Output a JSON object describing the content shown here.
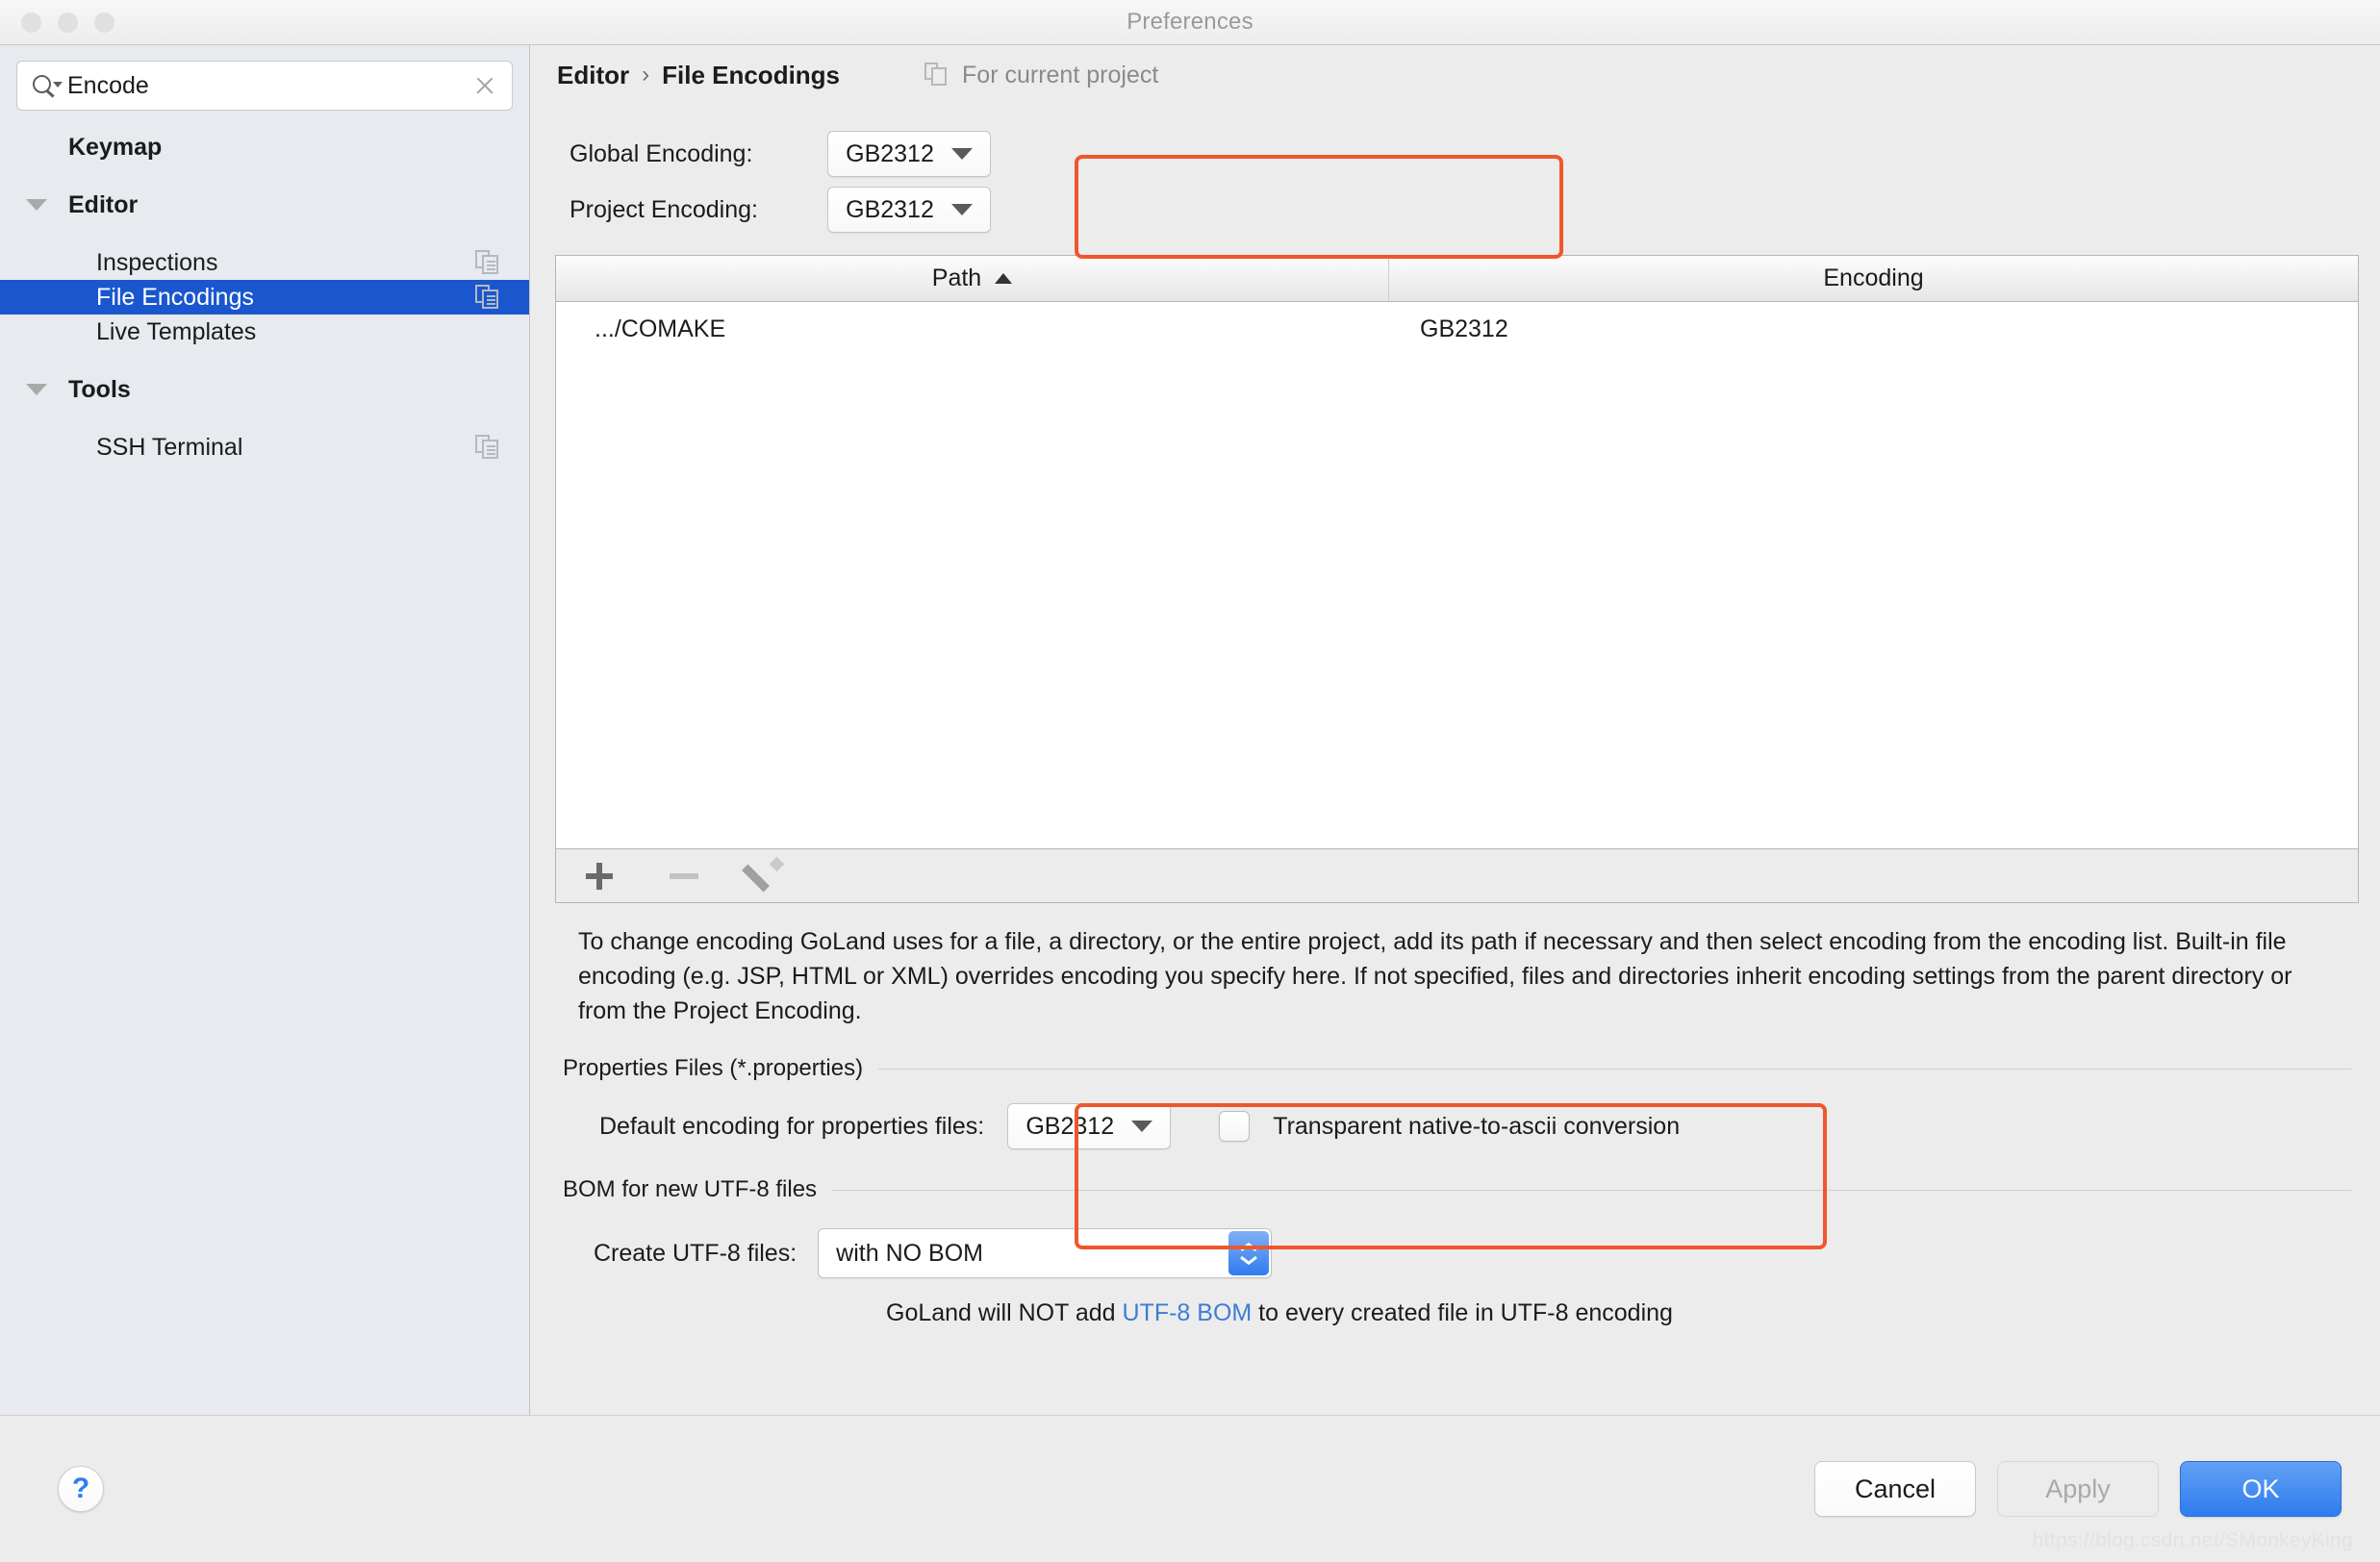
{
  "window": {
    "title": "Preferences"
  },
  "search": {
    "value": "Encode",
    "placeholder": "Search"
  },
  "sidebar": {
    "items": [
      {
        "label": "Keymap",
        "level": "top",
        "twisty": false,
        "copy": false,
        "selected": false
      },
      {
        "label": "Editor",
        "level": "top",
        "twisty": true,
        "copy": false,
        "selected": false
      },
      {
        "label": "Inspections",
        "level": "child",
        "twisty": false,
        "copy": true,
        "selected": false
      },
      {
        "label": "File Encodings",
        "level": "child",
        "twisty": false,
        "copy": true,
        "selected": true
      },
      {
        "label": "Live Templates",
        "level": "child",
        "twisty": false,
        "copy": false,
        "selected": false
      },
      {
        "label": "Tools",
        "level": "top",
        "twisty": true,
        "copy": false,
        "selected": false
      },
      {
        "label": "SSH Terminal",
        "level": "child",
        "twisty": false,
        "copy": true,
        "selected": false
      }
    ]
  },
  "header": {
    "breadcrumb_parent": "Editor",
    "breadcrumb_sep": "›",
    "breadcrumb_current": "File Encodings",
    "for_current_project": "For current project"
  },
  "encodings": {
    "global_label": "Global Encoding:",
    "global_value": "GB2312",
    "project_label": "Project Encoding:",
    "project_value": "GB2312"
  },
  "table": {
    "col_path": "Path",
    "col_encoding": "Encoding",
    "sort_indicator": "asc",
    "rows": [
      {
        "path": ".../COMAKE",
        "encoding": "GB2312"
      }
    ]
  },
  "toolbar": {
    "add": "+",
    "remove": "−",
    "edit": "edit"
  },
  "description": "To change encoding GoLand uses for a file, a directory, or the entire project, add its path if necessary and then select encoding from the encoding list. Built-in file encoding (e.g. JSP, HTML or XML) overrides encoding you specify here. If not specified, files and directories inherit encoding settings from the parent directory or from the Project Encoding.",
  "properties_group": {
    "title": "Properties Files (*.properties)",
    "default_encoding_label": "Default encoding for properties files:",
    "default_encoding_value": "GB2312",
    "transparent_label": "Transparent native-to-ascii conversion",
    "transparent_checked": false
  },
  "bom_group": {
    "title": "BOM for new UTF-8 files",
    "create_label": "Create UTF-8 files:",
    "create_value": "with NO BOM",
    "note_prefix": "GoLand will NOT add ",
    "note_link": "UTF-8 BOM",
    "note_suffix": " to every created file in UTF-8 encoding"
  },
  "footer": {
    "help": "?",
    "cancel": "Cancel",
    "apply": "Apply",
    "ok": "OK"
  },
  "watermark": "https://blog.csdn.net/SMonkeyKing",
  "colors": {
    "accent_blue": "#1a57ce",
    "highlight_orange": "#f0562d",
    "ok_blue": "#2f7cf0",
    "link_blue": "#3d7dd6"
  }
}
